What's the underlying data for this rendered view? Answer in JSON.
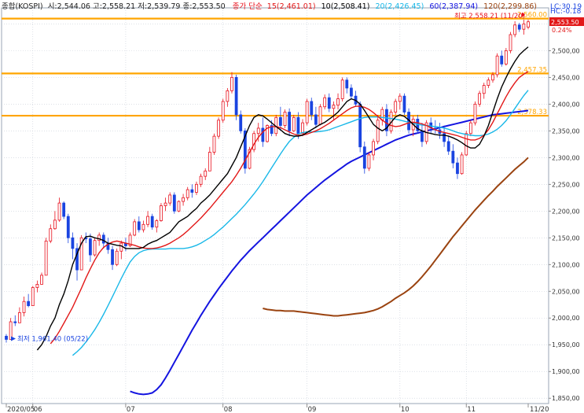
{
  "header": {
    "title": "종합(KOSPI)",
    "ohlc": "시:2,544.06 고:2,558.21 저:2,539.79 종:2,553.50",
    "ma_prefix": "종가 단순",
    "ma15": "15(2,461.01)",
    "ma10": "10(2,508.41)",
    "ma20": "20(2,426.45)",
    "ma60": "60(2,387.94)",
    "ma120": "120(2,299.86)"
  },
  "right_info": {
    "lc": "LC:30.19",
    "hc": "HC:-0.18",
    "change_pct": "0.24%"
  },
  "annotations": {
    "high": "최고 2,558.21 (11/20)",
    "low": "최저 1,961.40 (05/22)"
  },
  "colors": {
    "up": "#e8101c",
    "down": "#1a44e0",
    "ma10": "#000000",
    "ma15": "#e21818",
    "ma20": "#19b8e8",
    "ma60": "#1414e0",
    "ma120": "#9a4310",
    "hline": "#ffa500",
    "price_box": "#e21818"
  },
  "chart_data": {
    "type": "candlestick",
    "ylim": [
      1840,
      2580
    ],
    "y_ticks": [
      1850,
      1900,
      1950,
      2000,
      2050,
      2100,
      2150,
      2200,
      2250,
      2300,
      2350,
      2400,
      2450,
      2500,
      2550
    ],
    "y_tick_labels": [
      "1,850,00",
      "1,900,00",
      "1,950,00",
      "2,000,00",
      "2,050,00",
      "2,100,00",
      "2,150,00",
      "2,200,00",
      "2,250,00",
      "2,300,00",
      "2,350,00",
      "2,400,00",
      "2,450,00",
      "2,500,00"
    ],
    "x_labels": [
      {
        "label": "2020/05",
        "i": 0
      },
      {
        "label": "06",
        "i": 6
      },
      {
        "label": "07",
        "i": 27
      },
      {
        "label": "08",
        "i": 49
      },
      {
        "label": "09",
        "i": 68
      },
      {
        "label": "10",
        "i": 89
      },
      {
        "label": "11",
        "i": 104
      },
      {
        "label": "11/20",
        "i": 118
      }
    ],
    "hlines": [
      {
        "value": 2560.0,
        "label": "2,560.00"
      },
      {
        "value": 2457.35,
        "label": "2,457.35"
      },
      {
        "value": 2378.33,
        "label": "2,378.33"
      }
    ],
    "current_price": {
      "value": 2553.5,
      "label": "2,553.50"
    },
    "candles": [
      [
        1966,
        1970,
        1954,
        1960
      ],
      [
        1960,
        2000,
        1960,
        1993
      ],
      [
        1993,
        2005,
        1985,
        1991
      ],
      [
        1991,
        2020,
        1991,
        2010
      ],
      [
        2010,
        2040,
        2003,
        2031
      ],
      [
        2031,
        2045,
        2020,
        2023
      ],
      [
        2023,
        2060,
        2023,
        2057
      ],
      [
        2057,
        2070,
        2048,
        2063
      ],
      [
        2063,
        2085,
        2063,
        2080
      ],
      [
        2080,
        2150,
        2080,
        2144
      ],
      [
        2144,
        2175,
        2140,
        2167
      ],
      [
        2167,
        2200,
        2165,
        2183
      ],
      [
        2183,
        2225,
        2180,
        2215
      ],
      [
        2215,
        2218,
        2185,
        2190
      ],
      [
        2190,
        2195,
        2140,
        2150
      ],
      [
        2150,
        2160,
        2110,
        2130
      ],
      [
        2130,
        2140,
        2070,
        2090
      ],
      [
        2090,
        2155,
        2090,
        2150
      ],
      [
        2150,
        2160,
        2140,
        2148
      ],
      [
        2148,
        2158,
        2105,
        2118
      ],
      [
        2118,
        2150,
        2115,
        2145
      ],
      [
        2145,
        2160,
        2135,
        2155
      ],
      [
        2155,
        2160,
        2130,
        2140
      ],
      [
        2140,
        2150,
        2120,
        2128
      ],
      [
        2128,
        2135,
        2090,
        2100
      ],
      [
        2100,
        2130,
        2097,
        2125
      ],
      [
        2125,
        2145,
        2110,
        2140
      ],
      [
        2140,
        2150,
        2125,
        2135
      ],
      [
        2135,
        2160,
        2133,
        2155
      ],
      [
        2155,
        2185,
        2153,
        2180
      ],
      [
        2180,
        2190,
        2160,
        2165
      ],
      [
        2165,
        2182,
        2160,
        2175
      ],
      [
        2175,
        2200,
        2170,
        2190
      ],
      [
        2190,
        2195,
        2165,
        2170
      ],
      [
        2170,
        2185,
        2160,
        2182
      ],
      [
        2182,
        2215,
        2180,
        2210
      ],
      [
        2210,
        2225,
        2200,
        2215
      ],
      [
        2215,
        2235,
        2210,
        2230
      ],
      [
        2230,
        2235,
        2195,
        2200
      ],
      [
        2200,
        2220,
        2198,
        2218
      ],
      [
        2218,
        2232,
        2210,
        2225
      ],
      [
        2225,
        2245,
        2220,
        2240
      ],
      [
        2240,
        2250,
        2225,
        2235
      ],
      [
        2235,
        2255,
        2230,
        2250
      ],
      [
        2250,
        2270,
        2245,
        2265
      ],
      [
        2265,
        2280,
        2258,
        2275
      ],
      [
        2275,
        2320,
        2275,
        2310
      ],
      [
        2310,
        2345,
        2305,
        2340
      ],
      [
        2340,
        2375,
        2335,
        2370
      ],
      [
        2370,
        2410,
        2365,
        2405
      ],
      [
        2405,
        2430,
        2395,
        2425
      ],
      [
        2425,
        2460,
        2420,
        2450
      ],
      [
        2450,
        2455,
        2370,
        2380
      ],
      [
        2380,
        2388,
        2345,
        2350
      ],
      [
        2350,
        2355,
        2270,
        2280
      ],
      [
        2280,
        2320,
        2278,
        2315
      ],
      [
        2315,
        2350,
        2310,
        2345
      ],
      [
        2345,
        2365,
        2330,
        2355
      ],
      [
        2355,
        2375,
        2320,
        2330
      ],
      [
        2330,
        2362,
        2328,
        2360
      ],
      [
        2360,
        2370,
        2340,
        2345
      ],
      [
        2345,
        2380,
        2340,
        2375
      ],
      [
        2375,
        2395,
        2350,
        2360
      ],
      [
        2360,
        2390,
        2355,
        2385
      ],
      [
        2385,
        2392,
        2340,
        2350
      ],
      [
        2350,
        2380,
        2348,
        2375
      ],
      [
        2375,
        2385,
        2335,
        2345
      ],
      [
        2345,
        2372,
        2340,
        2365
      ],
      [
        2365,
        2410,
        2360,
        2405
      ],
      [
        2405,
        2412,
        2370,
        2380
      ],
      [
        2380,
        2395,
        2355,
        2362
      ],
      [
        2362,
        2400,
        2360,
        2395
      ],
      [
        2395,
        2418,
        2390,
        2412
      ],
      [
        2412,
        2420,
        2385,
        2392
      ],
      [
        2392,
        2405,
        2370,
        2398
      ],
      [
        2398,
        2420,
        2390,
        2410
      ],
      [
        2410,
        2450,
        2405,
        2445
      ],
      [
        2445,
        2450,
        2420,
        2430
      ],
      [
        2430,
        2437,
        2410,
        2415
      ],
      [
        2415,
        2425,
        2395,
        2400
      ],
      [
        2400,
        2405,
        2310,
        2320
      ],
      [
        2320,
        2330,
        2270,
        2280
      ],
      [
        2280,
        2310,
        2275,
        2305
      ],
      [
        2305,
        2335,
        2295,
        2330
      ],
      [
        2330,
        2380,
        2325,
        2370
      ],
      [
        2370,
        2395,
        2360,
        2390
      ],
      [
        2390,
        2400,
        2340,
        2350
      ],
      [
        2350,
        2390,
        2345,
        2385
      ],
      [
        2385,
        2410,
        2380,
        2405
      ],
      [
        2405,
        2420,
        2390,
        2415
      ],
      [
        2415,
        2420,
        2380,
        2385
      ],
      [
        2385,
        2392,
        2345,
        2352
      ],
      [
        2352,
        2378,
        2340,
        2372
      ],
      [
        2372,
        2380,
        2345,
        2350
      ],
      [
        2350,
        2365,
        2320,
        2330
      ],
      [
        2330,
        2370,
        2325,
        2365
      ],
      [
        2365,
        2375,
        2345,
        2355
      ],
      [
        2355,
        2370,
        2345,
        2352
      ],
      [
        2352,
        2365,
        2335,
        2345
      ],
      [
        2345,
        2360,
        2320,
        2330
      ],
      [
        2330,
        2340,
        2305,
        2312
      ],
      [
        2312,
        2325,
        2280,
        2290
      ],
      [
        2290,
        2300,
        2260,
        2270
      ],
      [
        2270,
        2310,
        2268,
        2305
      ],
      [
        2305,
        2350,
        2303,
        2345
      ],
      [
        2345,
        2370,
        2340,
        2365
      ],
      [
        2365,
        2405,
        2360,
        2400
      ],
      [
        2400,
        2425,
        2395,
        2420
      ],
      [
        2420,
        2440,
        2410,
        2435
      ],
      [
        2435,
        2450,
        2430,
        2445
      ],
      [
        2445,
        2460,
        2440,
        2455
      ],
      [
        2455,
        2495,
        2450,
        2490
      ],
      [
        2490,
        2500,
        2470,
        2475
      ],
      [
        2475,
        2505,
        2472,
        2500
      ],
      [
        2500,
        2535,
        2495,
        2530
      ],
      [
        2530,
        2555,
        2525,
        2548
      ],
      [
        2548,
        2552,
        2535,
        2540
      ],
      [
        2540,
        2558,
        2530,
        2550
      ],
      [
        2544,
        2558,
        2540,
        2554
      ]
    ],
    "series": [
      {
        "name": "10",
        "color": "#000000",
        "values": [
          1940,
          1950,
          1965,
          1985,
          2000,
          2025,
          2045,
          2070,
          2100,
          2120,
          2140,
          2152,
          2153,
          2150,
          2148,
          2145,
          2140,
          2138,
          2136,
          2135,
          2130,
          2130,
          2130,
          2130,
          2132,
          2138,
          2142,
          2145,
          2150,
          2155,
          2160,
          2170,
          2180,
          2185,
          2190,
          2198,
          2205,
          2215,
          2222,
          2230,
          2240,
          2250,
          2260,
          2270,
          2285,
          2300,
          2320,
          2340,
          2360,
          2375,
          2380,
          2378,
          2372,
          2365,
          2358,
          2352,
          2345,
          2342,
          2340,
          2340,
          2342,
          2347,
          2352,
          2357,
          2362,
          2366,
          2372,
          2378,
          2385,
          2395,
          2405,
          2410,
          2407,
          2400,
          2388,
          2375,
          2362,
          2355,
          2350,
          2355,
          2366,
          2376,
          2380,
          2377,
          2370,
          2362,
          2354,
          2350,
          2347,
          2345,
          2343,
          2342,
          2342,
          2340,
          2337,
          2333,
          2328,
          2322,
          2318,
          2318,
          2325,
          2340,
          2360,
          2385,
          2410,
          2432,
          2450,
          2466,
          2480,
          2492,
          2500,
          2507
        ]
      },
      {
        "name": "15",
        "color": "#e21818",
        "values": [
          1952,
          1962,
          1975,
          1990,
          2005,
          2020,
          2038,
          2056,
          2075,
          2092,
          2108,
          2122,
          2132,
          2138,
          2142,
          2144,
          2142,
          2140,
          2138,
          2136,
          2133,
          2131,
          2130,
          2130,
          2131,
          2133,
          2136,
          2140,
          2145,
          2150,
          2156,
          2163,
          2171,
          2179,
          2187,
          2196,
          2205,
          2215,
          2225,
          2235,
          2245,
          2255,
          2267,
          2280,
          2295,
          2310,
          2325,
          2338,
          2348,
          2355,
          2358,
          2358,
          2356,
          2352,
          2348,
          2344,
          2342,
          2342,
          2344,
          2347,
          2350,
          2354,
          2359,
          2364,
          2370,
          2376,
          2382,
          2388,
          2393,
          2396,
          2396,
          2394,
          2390,
          2384,
          2377,
          2370,
          2364,
          2360,
          2358,
          2359,
          2362,
          2365,
          2366,
          2365,
          2363,
          2360,
          2356,
          2352,
          2349,
          2347,
          2345,
          2343,
          2341,
          2338,
          2335,
          2333,
          2333,
          2336,
          2342,
          2352,
          2366,
          2382,
          2398,
          2414,
          2428,
          2440,
          2450,
          2456,
          2461
        ]
      },
      {
        "name": "20",
        "color": "#19b8e8",
        "values": [
          1930,
          1937,
          1945,
          1955,
          1966,
          1978,
          1992,
          2007,
          2023,
          2040,
          2057,
          2074,
          2090,
          2105,
          2115,
          2122,
          2126,
          2128,
          2129,
          2129,
          2129,
          2129,
          2130,
          2130,
          2130,
          2130,
          2131,
          2133,
          2136,
          2140,
          2145,
          2150,
          2156,
          2163,
          2170,
          2178,
          2186,
          2194,
          2203,
          2212,
          2222,
          2232,
          2243,
          2255,
          2268,
          2281,
          2294,
          2307,
          2319,
          2330,
          2338,
          2344,
          2347,
          2348,
          2348,
          2348,
          2349,
          2350,
          2352,
          2355,
          2358,
          2361,
          2364,
          2367,
          2370,
          2373,
          2375,
          2376,
          2376,
          2376,
          2375,
          2374,
          2373,
          2372,
          2370,
          2368,
          2366,
          2364,
          2362,
          2361,
          2360,
          2359,
          2358,
          2357,
          2355,
          2353,
          2350,
          2347,
          2345,
          2343,
          2342,
          2341,
          2341,
          2342,
          2344,
          2348,
          2353,
          2360,
          2369,
          2380,
          2392,
          2404,
          2416,
          2426
        ]
      },
      {
        "name": "60",
        "color": "#1414e0",
        "values": [
          1863,
          1860,
          1858,
          1857,
          1858,
          1860,
          1866,
          1875,
          1888,
          1902,
          1917,
          1932,
          1947,
          1962,
          1977,
          1991,
          2005,
          2018,
          2031,
          2043,
          2055,
          2066,
          2077,
          2088,
          2098,
          2108,
          2117,
          2126,
          2134,
          2142,
          2150,
          2158,
          2166,
          2174,
          2182,
          2190,
          2198,
          2206,
          2214,
          2222,
          2230,
          2237,
          2244,
          2251,
          2258,
          2264,
          2270,
          2276,
          2282,
          2288,
          2293,
          2297,
          2301,
          2305,
          2309,
          2313,
          2317,
          2321,
          2325,
          2329,
          2333,
          2336,
          2339,
          2342,
          2344,
          2346,
          2348,
          2350,
          2352,
          2354,
          2356,
          2358,
          2360,
          2362,
          2364,
          2366,
          2368,
          2370,
          2372,
          2374,
          2376,
          2378,
          2380,
          2381,
          2382,
          2383,
          2384,
          2385,
          2386,
          2387,
          2388
        ]
      },
      {
        "name": "120",
        "color": "#9a4310",
        "values": [
          2018,
          2016,
          2015,
          2014,
          2014,
          2013,
          2013,
          2013,
          2012,
          2011,
          2010,
          2009,
          2008,
          2007,
          2006,
          2005,
          2004,
          2004,
          2005,
          2006,
          2007,
          2008,
          2009,
          2010,
          2012,
          2014,
          2017,
          2021,
          2026,
          2031,
          2037,
          2042,
          2047,
          2053,
          2060,
          2068,
          2077,
          2087,
          2097,
          2108,
          2119,
          2130,
          2141,
          2152,
          2162,
          2172,
          2182,
          2192,
          2202,
          2211,
          2220,
          2229,
          2237,
          2246,
          2254,
          2262,
          2270,
          2278,
          2285,
          2292,
          2300
        ]
      }
    ]
  }
}
